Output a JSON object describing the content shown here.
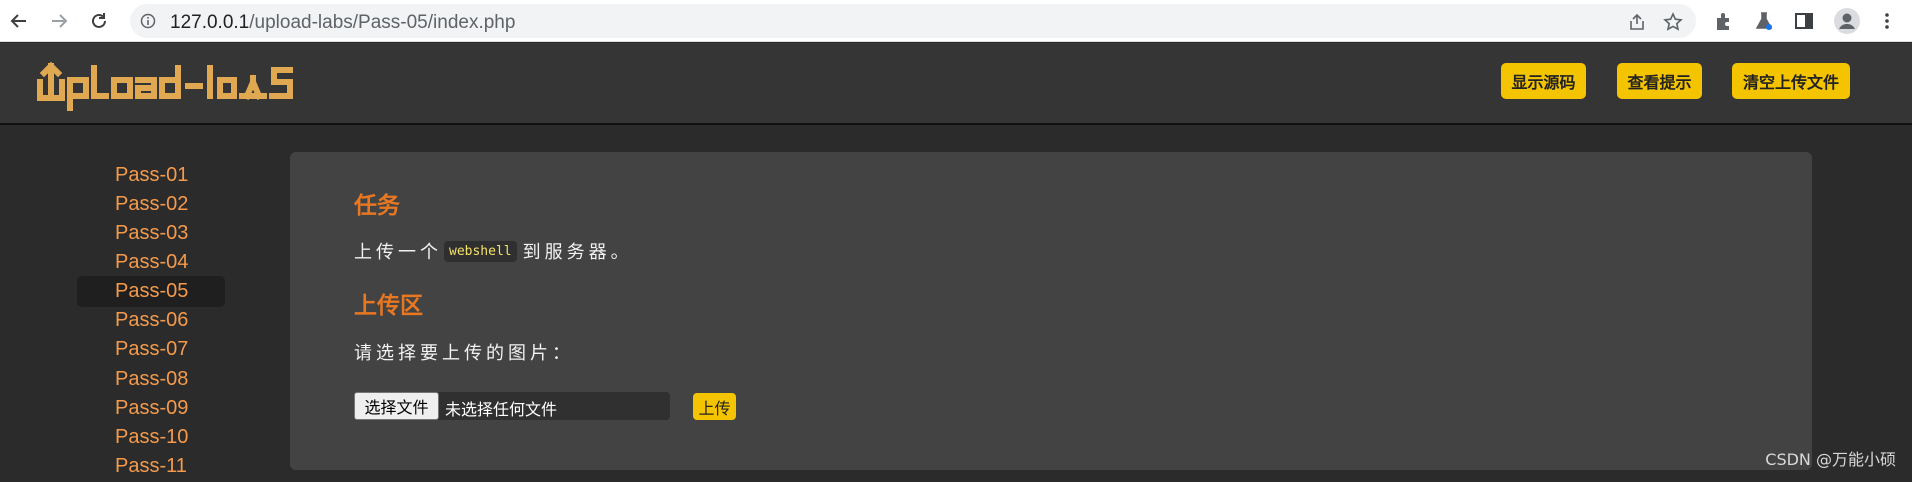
{
  "browser": {
    "url_host": "127.0.0.1",
    "url_path": "/upload-labs/Pass-05/index.php"
  },
  "header": {
    "logo_text": "upload-labs",
    "buttons": [
      "显示源码",
      "查看提示",
      "清空上传文件"
    ]
  },
  "sidebar": {
    "items": [
      "Pass-01",
      "Pass-02",
      "Pass-03",
      "Pass-04",
      "Pass-05",
      "Pass-06",
      "Pass-07",
      "Pass-08",
      "Pass-09",
      "Pass-10",
      "Pass-11"
    ],
    "active": "Pass-05"
  },
  "main": {
    "task_title": "任务",
    "task_prefix": "上传一个",
    "task_code": "webshell",
    "task_suffix": "到服务器。",
    "upload_title": "上传区",
    "select_prompt": "请选择要上传的图片：",
    "choose_file_label": "选择文件",
    "no_file_text": "未选择任何文件",
    "upload_label": "上传"
  },
  "watermark": "CSDN @万能小硕",
  "colors": {
    "accent_yellow": "#f5c400",
    "link_orange": "#f59a4b",
    "title_orange": "#e87722"
  }
}
